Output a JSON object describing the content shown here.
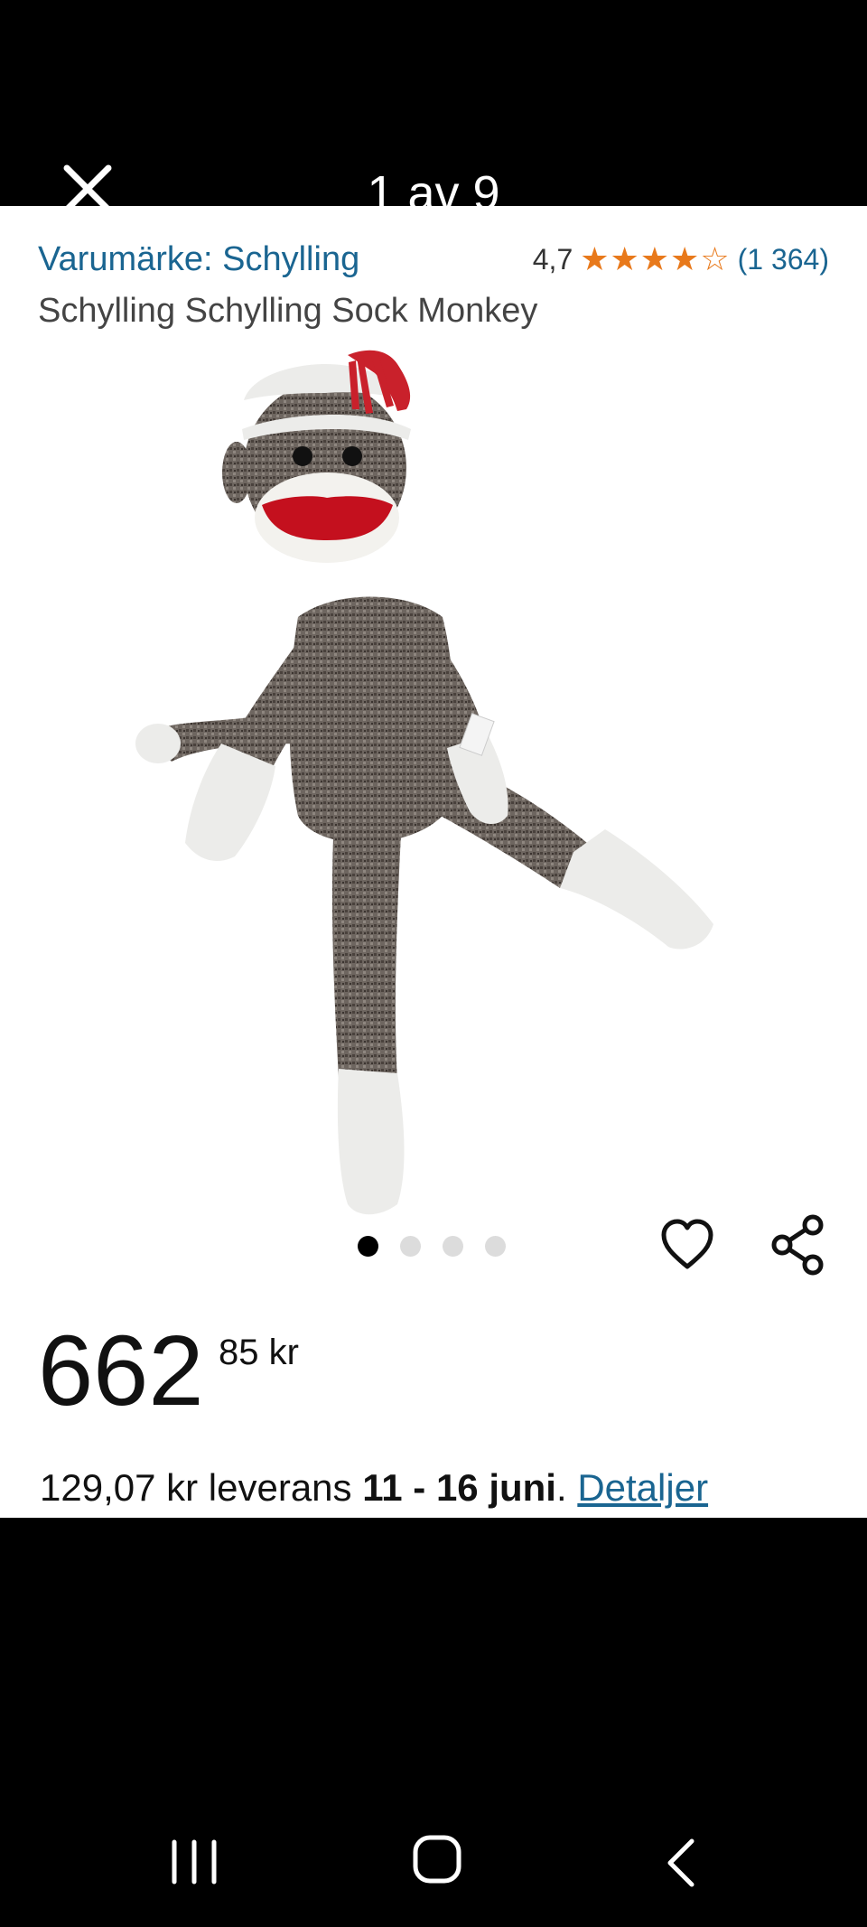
{
  "header": {
    "close_icon": "close-icon",
    "counter": "1 av 9"
  },
  "product": {
    "brand": "Varumärke: Schylling",
    "rating_value": "4,7",
    "rating_stars": "★★★★☆",
    "rating_count": "(1 364)",
    "title": "Schylling Schylling Sock Monkey",
    "image_alt": "sock-monkey-plush"
  },
  "gallery": {
    "total_dots": 4,
    "active_index": 0,
    "heart_icon": "heart-icon",
    "share_icon": "share-icon"
  },
  "price": {
    "whole": "662",
    "fraction": "85 kr"
  },
  "delivery": {
    "prefix": "129,07 kr leverans ",
    "dates": "11 - 16 juni",
    "separator": ". ",
    "link": "Detaljer"
  },
  "system_nav": {
    "recents": "recents-icon",
    "home": "home-icon",
    "back": "back-icon"
  },
  "colors": {
    "link": "#1a6591",
    "star": "#e8791b",
    "background": "#ffffff"
  }
}
